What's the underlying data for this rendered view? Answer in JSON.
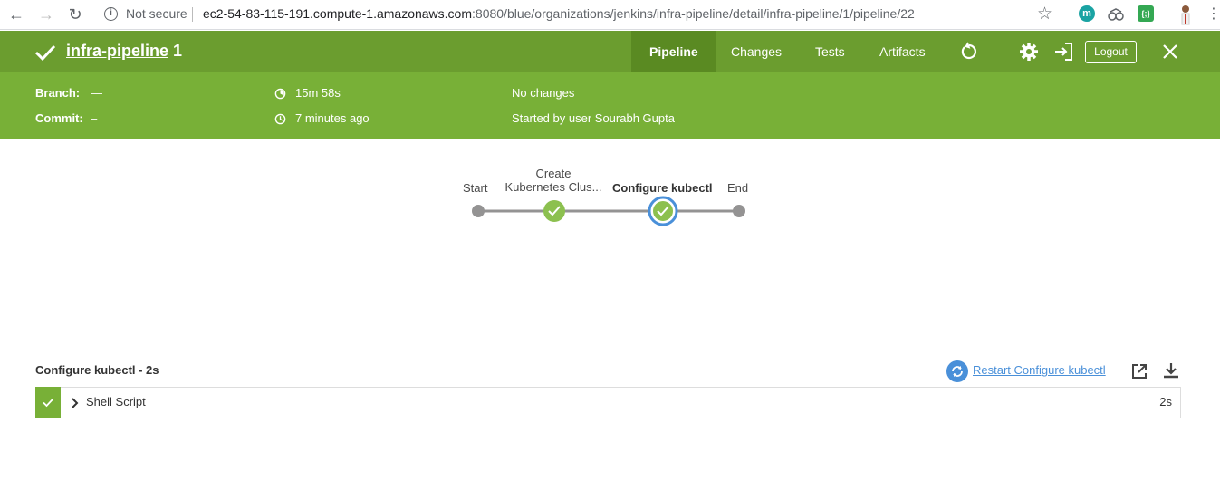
{
  "browser": {
    "security_label": "Not secure",
    "url_host": "ec2-54-83-115-191.compute-1.amazonaws.com",
    "url_path": ":8080/blue/organizations/jenkins/infra-pipeline/detail/infra-pipeline/1/pipeline/22",
    "extensions": [
      {
        "label": "m",
        "color": "#1aa3a3"
      },
      {
        "label": "{;}",
        "color": "#34a853"
      }
    ]
  },
  "header": {
    "title": "infra-pipeline",
    "run_number": "1",
    "tabs": [
      {
        "label": "Pipeline",
        "active": true
      },
      {
        "label": "Changes",
        "active": false
      },
      {
        "label": "Tests",
        "active": false
      },
      {
        "label": "Artifacts",
        "active": false
      }
    ],
    "logout_label": "Logout"
  },
  "run_info": {
    "branch_label": "Branch:",
    "branch_value": "—",
    "commit_label": "Commit:",
    "commit_value": "–",
    "duration": "15m 58s",
    "started": "7 minutes ago",
    "changes": "No changes",
    "started_by": "Started by user Sourabh Gupta"
  },
  "pipeline": {
    "stages": [
      {
        "label": "Start",
        "type": "start"
      },
      {
        "label": "Create\nKubernetes Clus...",
        "line1": "Create",
        "line2": "Kubernetes Clus...",
        "type": "success"
      },
      {
        "label": "Configure kubectl",
        "type": "success-selected"
      },
      {
        "label": "End",
        "type": "end"
      }
    ]
  },
  "steps_panel": {
    "title": "Configure kubectl - 2s",
    "restart_label": "Restart Configure kubectl",
    "steps": [
      {
        "name": "Shell Script",
        "duration": "2s",
        "status": "success"
      }
    ]
  },
  "colors": {
    "header_dark": "#6b9d2f",
    "header_light": "#78b037",
    "success": "#8cc04f",
    "selected_ring": "#4a90d9",
    "link": "#4a90d9"
  }
}
